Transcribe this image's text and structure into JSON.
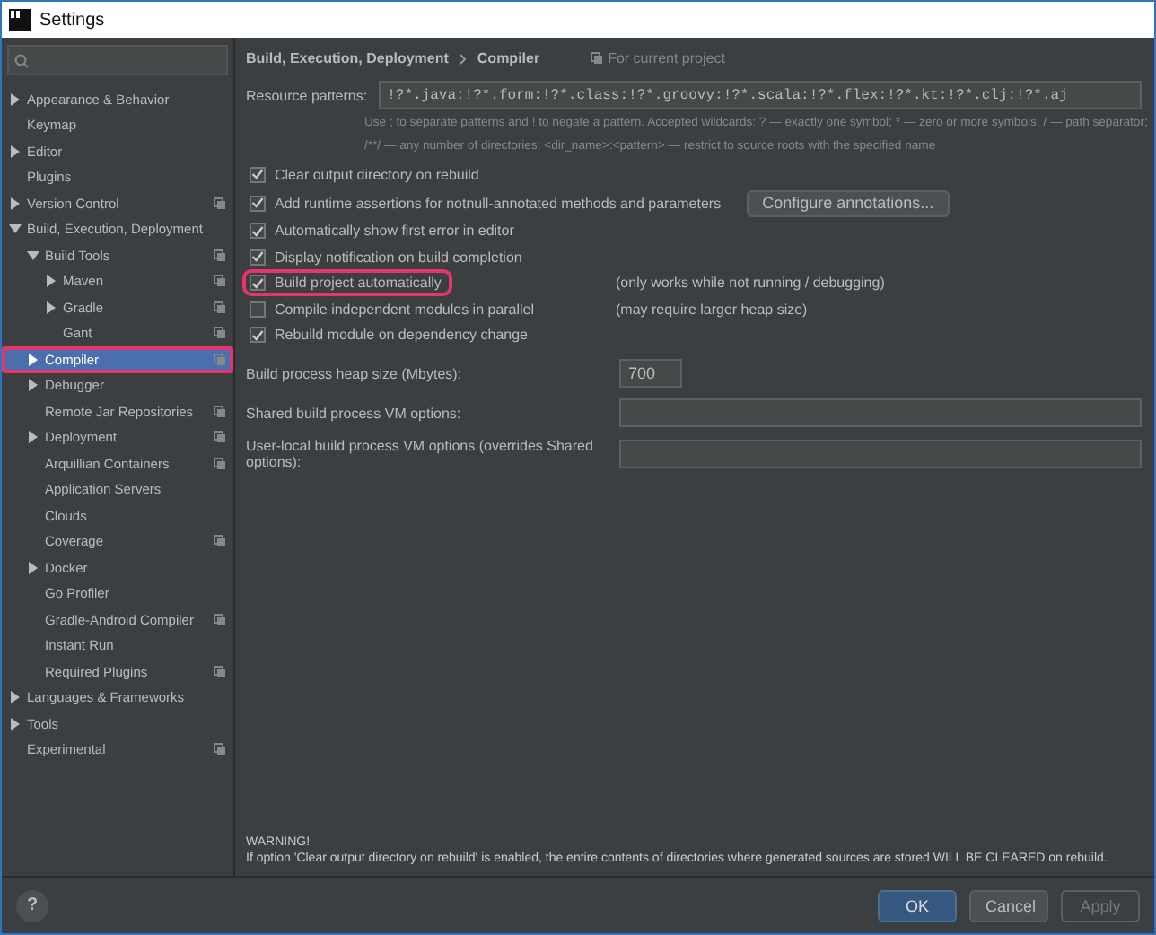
{
  "window": {
    "title": "Settings"
  },
  "sidebar": {
    "tree": [
      {
        "label": "Appearance & Behavior",
        "kind": "folder",
        "expanded": false,
        "project_scoped": false,
        "selected": false,
        "highlighted": false
      },
      {
        "label": "Keymap",
        "kind": "leaf",
        "project_scoped": false,
        "selected": false,
        "highlighted": false
      },
      {
        "label": "Editor",
        "kind": "folder",
        "expanded": false,
        "project_scoped": false,
        "selected": false,
        "highlighted": false
      },
      {
        "label": "Plugins",
        "kind": "leaf",
        "project_scoped": false,
        "selected": false,
        "highlighted": false
      },
      {
        "label": "Version Control",
        "kind": "folder",
        "expanded": false,
        "project_scoped": true,
        "selected": false,
        "highlighted": false
      },
      {
        "label": "Build, Execution, Deployment",
        "kind": "folder",
        "expanded": true,
        "project_scoped": false,
        "selected": false,
        "highlighted": false,
        "children": [
          {
            "label": "Build Tools",
            "kind": "folder",
            "expanded": true,
            "project_scoped": true,
            "selected": false,
            "highlighted": false,
            "children": [
              {
                "label": "Maven",
                "kind": "folder",
                "expanded": false,
                "project_scoped": true,
                "selected": false,
                "highlighted": false
              },
              {
                "label": "Gradle",
                "kind": "folder",
                "expanded": false,
                "project_scoped": true,
                "selected": false,
                "highlighted": false
              },
              {
                "label": "Gant",
                "kind": "leaf",
                "project_scoped": true,
                "selected": false,
                "highlighted": false
              }
            ]
          },
          {
            "label": "Compiler",
            "kind": "folder",
            "expanded": false,
            "project_scoped": true,
            "selected": true,
            "highlighted": true
          },
          {
            "label": "Debugger",
            "kind": "folder",
            "expanded": false,
            "project_scoped": false,
            "selected": false,
            "highlighted": false
          },
          {
            "label": "Remote Jar Repositories",
            "kind": "leaf",
            "project_scoped": true,
            "selected": false,
            "highlighted": false
          },
          {
            "label": "Deployment",
            "kind": "folder",
            "expanded": false,
            "project_scoped": true,
            "selected": false,
            "highlighted": false
          },
          {
            "label": "Arquillian Containers",
            "kind": "leaf",
            "project_scoped": true,
            "selected": false,
            "highlighted": false
          },
          {
            "label": "Application Servers",
            "kind": "leaf",
            "project_scoped": false,
            "selected": false,
            "highlighted": false
          },
          {
            "label": "Clouds",
            "kind": "leaf",
            "project_scoped": false,
            "selected": false,
            "highlighted": false
          },
          {
            "label": "Coverage",
            "kind": "leaf",
            "project_scoped": true,
            "selected": false,
            "highlighted": false
          },
          {
            "label": "Docker",
            "kind": "folder",
            "expanded": false,
            "project_scoped": false,
            "selected": false,
            "highlighted": false
          },
          {
            "label": "Go Profiler",
            "kind": "leaf",
            "project_scoped": false,
            "selected": false,
            "highlighted": false
          },
          {
            "label": "Gradle-Android Compiler",
            "kind": "leaf",
            "project_scoped": true,
            "selected": false,
            "highlighted": false
          },
          {
            "label": "Instant Run",
            "kind": "leaf",
            "project_scoped": false,
            "selected": false,
            "highlighted": false
          },
          {
            "label": "Required Plugins",
            "kind": "leaf",
            "project_scoped": true,
            "selected": false,
            "highlighted": false
          }
        ]
      },
      {
        "label": "Languages & Frameworks",
        "kind": "folder",
        "expanded": false,
        "project_scoped": false,
        "selected": false,
        "highlighted": false
      },
      {
        "label": "Tools",
        "kind": "folder",
        "expanded": false,
        "project_scoped": false,
        "selected": false,
        "highlighted": false
      },
      {
        "label": "Experimental",
        "kind": "leaf",
        "project_scoped": true,
        "selected": false,
        "highlighted": false
      }
    ]
  },
  "breadcrumb": [
    "Build, Execution, Deployment",
    "Compiler"
  ],
  "scope_note": "For current project",
  "resource_patterns": {
    "label": "Resource patterns:",
    "value": "!?*.java:!?*.form:!?*.class:!?*.groovy:!?*.scala:!?*.flex:!?*.kt:!?*.clj:!?*.aj",
    "hint": [
      "Use ; to separate patterns and ! to negate a pattern. Accepted wildcards: ? — exactly one symbol; * — zero or more symbols; / — path separator;",
      "/**/ — any number of directories; <dir_name>:<pattern> — restrict to source roots with the specified name"
    ]
  },
  "options": [
    {
      "label": "Clear output directory on rebuild",
      "checked": true,
      "highlighted": false
    },
    {
      "label": "Add runtime assertions for notnull-annotated methods and parameters",
      "checked": true,
      "highlighted": false,
      "button": "Configure annotations..."
    },
    {
      "label": "Automatically show first error in editor",
      "checked": true,
      "highlighted": false
    },
    {
      "label": "Display notification on build completion",
      "checked": true,
      "highlighted": false
    },
    {
      "label": "Build project automatically",
      "checked": true,
      "highlighted": true,
      "note": "(only works while not running / debugging)"
    },
    {
      "label": "Compile independent modules in parallel",
      "checked": false,
      "highlighted": false,
      "note": "(may require larger heap size)"
    },
    {
      "label": "Rebuild module on dependency change",
      "checked": true,
      "highlighted": false
    }
  ],
  "fields": [
    {
      "label": "Build process heap size (Mbytes):",
      "value": "700",
      "kind": "short"
    },
    {
      "label": "Shared build process VM options:",
      "kind": "wide"
    },
    {
      "label": "User-local build process VM options (overrides Shared options):",
      "kind": "wide"
    }
  ],
  "warning": {
    "title": "WARNING!",
    "text": "If option 'Clear output directory on rebuild' is enabled, the entire contents of directories where generated sources are stored WILL BE CLEARED on rebuild."
  },
  "footer": {
    "help": "?",
    "buttons": [
      {
        "label": "OK",
        "kind": "primary",
        "disabled": false
      },
      {
        "label": "Cancel",
        "kind": "normal",
        "disabled": false
      },
      {
        "label": "Apply",
        "kind": "normal",
        "disabled": true
      }
    ]
  }
}
